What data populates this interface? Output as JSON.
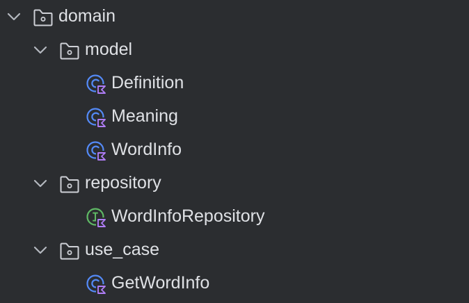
{
  "colors": {
    "background": "#2b2d30",
    "text": "#dfe1e5",
    "folder_icon": "#ced0d6",
    "chevron": "#b4b8bf",
    "class_icon": "#548af7",
    "interface_icon": "#5fb865",
    "kotlin_badge": "#b07df7"
  },
  "tree": {
    "domain": {
      "label": "domain",
      "icon": "folder-icon",
      "expanded": true
    },
    "model": {
      "label": "model",
      "icon": "folder-icon",
      "expanded": true
    },
    "definition": {
      "label": "Definition",
      "icon": "kotlin-class-icon"
    },
    "meaning": {
      "label": "Meaning",
      "icon": "kotlin-class-icon"
    },
    "word_info": {
      "label": "WordInfo",
      "icon": "kotlin-class-icon"
    },
    "repository": {
      "label": "repository",
      "icon": "folder-icon",
      "expanded": true
    },
    "word_info_repository": {
      "label": "WordInfoRepository",
      "icon": "kotlin-interface-icon"
    },
    "use_case": {
      "label": "use_case",
      "icon": "folder-icon",
      "expanded": true
    },
    "get_word_info": {
      "label": "GetWordInfo",
      "icon": "kotlin-class-icon"
    }
  }
}
